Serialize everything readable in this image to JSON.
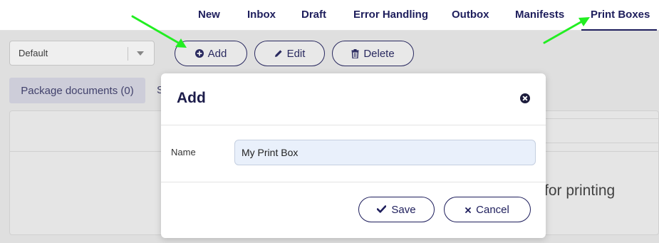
{
  "nav": {
    "items": [
      {
        "label": "New"
      },
      {
        "label": "Inbox"
      },
      {
        "label": "Draft"
      },
      {
        "label": "Error Handling"
      },
      {
        "label": "Outbox"
      },
      {
        "label": "Manifests"
      },
      {
        "label": "Print Boxes",
        "active": true
      }
    ]
  },
  "toolbar": {
    "select_value": "Default",
    "add_label": "Add",
    "edit_label": "Edit",
    "delete_label": "Delete"
  },
  "content": {
    "tab_package_documents": "Package documents (0)",
    "tab_partial": "S",
    "empty_text_partial": "for printing"
  },
  "modal": {
    "title": "Add",
    "name_label": "Name",
    "name_value": "My Print Box",
    "save_label": "Save",
    "cancel_label": "Cancel"
  },
  "colors": {
    "primary": "#1e1e5c",
    "annotation_arrow": "#22ee22",
    "input_bg": "#e9f0fb"
  }
}
